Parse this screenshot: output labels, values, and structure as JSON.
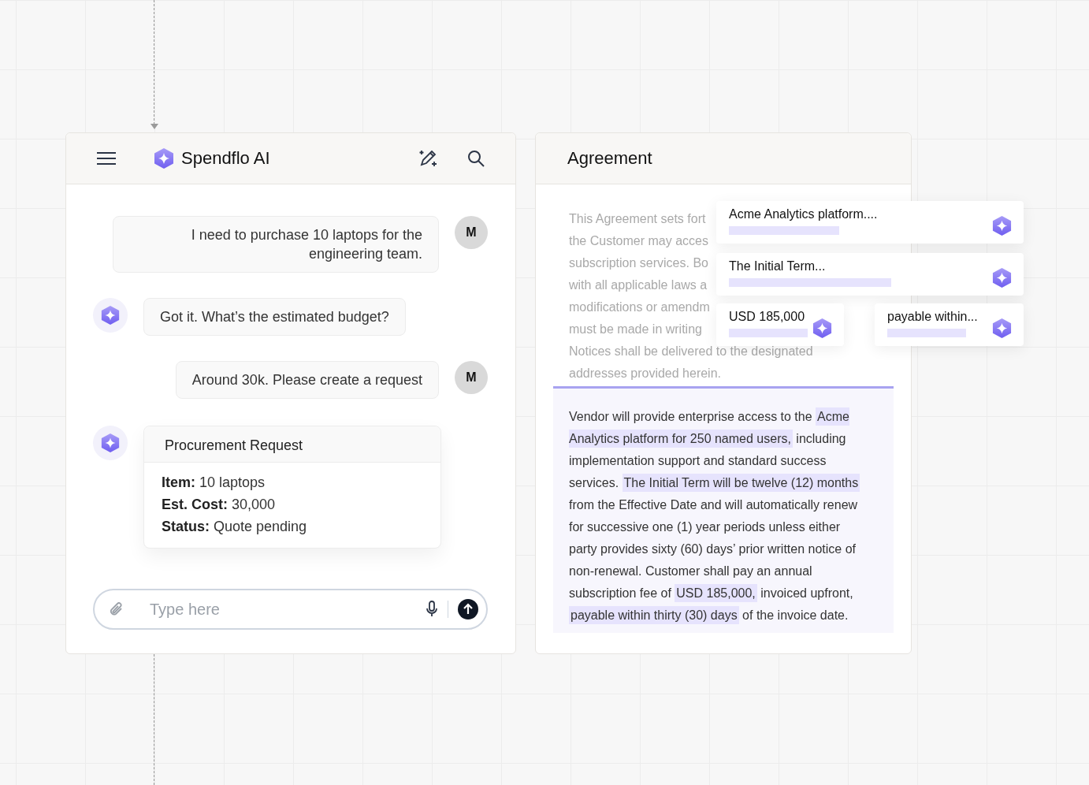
{
  "chat": {
    "title": "Spendflo AI",
    "messages": [
      {
        "kind": "user",
        "text": "I need to purchase 10 laptops for the engineering team.",
        "avatar": "M"
      },
      {
        "kind": "assistant",
        "text": "Got it. What’s the estimated budget?"
      },
      {
        "kind": "user",
        "text": "Around 30k. Please create a request",
        "avatar": "M"
      },
      {
        "kind": "card",
        "title": "Procurement Request",
        "fields": [
          {
            "label": "Item:",
            "value": "10 laptops"
          },
          {
            "label": "Est. Cost:",
            "value": "30,000"
          },
          {
            "label": "Status:",
            "value": "Quote pending"
          }
        ]
      }
    ],
    "input": {
      "placeholder": "Type here"
    }
  },
  "agreement": {
    "title": "Agreement",
    "faded_lines": [
      "This Agreement sets fort",
      "the Customer may acces",
      "subscription services. Bo",
      "with all applicable laws a",
      "modifications or amendm",
      "must be made in writing",
      "Notices shall be delivered to the designated",
      "addresses provided herein."
    ],
    "paragraph": [
      {
        "text": "Vendor will provide enterprise access to the ",
        "highlighted": false
      },
      {
        "text": "Acme Analytics platform for 250 named users,",
        "highlighted": true
      },
      {
        "text": " including implementation support and standard success services. ",
        "highlighted": false
      },
      {
        "text": "The Initial Term will be twelve (12) months",
        "highlighted": true
      },
      {
        "text": " from the Effective Date and will automatically renew for successive one (1) year periods unless either party provides sixty (60) days’ prior written notice of non-renewal. Customer shall pay an annual subscription fee of ",
        "highlighted": false
      },
      {
        "text": "USD 185,000,",
        "highlighted": true
      },
      {
        "text": " invoiced upfront, ",
        "highlighted": false
      },
      {
        "text": "payable within thirty (30) days",
        "highlighted": true
      },
      {
        "text": " of the invoice date.",
        "highlighted": false
      }
    ],
    "extractions": [
      {
        "text": "Acme Analytics platform...."
      },
      {
        "text": "The Initial Term..."
      },
      {
        "text": "USD 185,000"
      },
      {
        "text": "payable within..."
      }
    ]
  }
}
